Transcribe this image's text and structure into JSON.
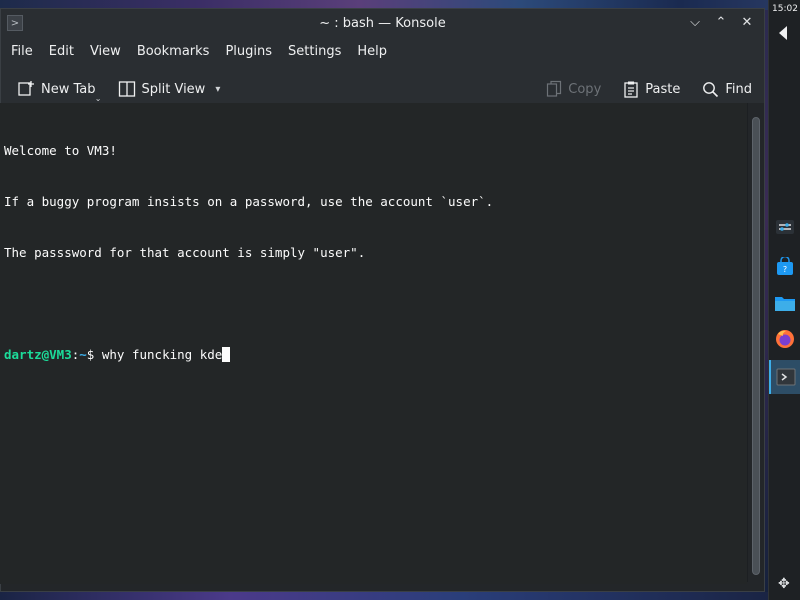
{
  "window": {
    "title": "~ : bash — Konsole",
    "app_icon_glyph": ">"
  },
  "window_buttons": {
    "minimize_glyph": "⌵",
    "maximize_glyph": "⌃",
    "close_glyph": "✕"
  },
  "menu": {
    "items": [
      "File",
      "Edit",
      "View",
      "Bookmarks",
      "Plugins",
      "Settings",
      "Help"
    ]
  },
  "toolbar": {
    "new_tab": "New Tab",
    "split_view": "Split View",
    "copy": "Copy",
    "paste": "Paste",
    "find": "Find"
  },
  "terminal": {
    "lines": [
      "Welcome to VM3!",
      "If a buggy program insists on a password, use the account `user`.",
      "The passsword for that account is simply \"user\".",
      ""
    ],
    "prompt": {
      "user_host": "dartz@VM3",
      "colon": ":",
      "path": "~",
      "symbol": "$ ",
      "command": "why funcking kde"
    }
  },
  "panel": {
    "clock": "15:02",
    "tasks": [
      "settings-icon",
      "discover-store-icon",
      "file-manager-icon",
      "firefox-icon",
      "konsole-icon"
    ],
    "active_task": "konsole-icon"
  },
  "colors": {
    "prompt_user": "#1cdc9a",
    "prompt_path": "#3daee9",
    "terminal_bg": "#232627",
    "accent": "#3daee9"
  }
}
